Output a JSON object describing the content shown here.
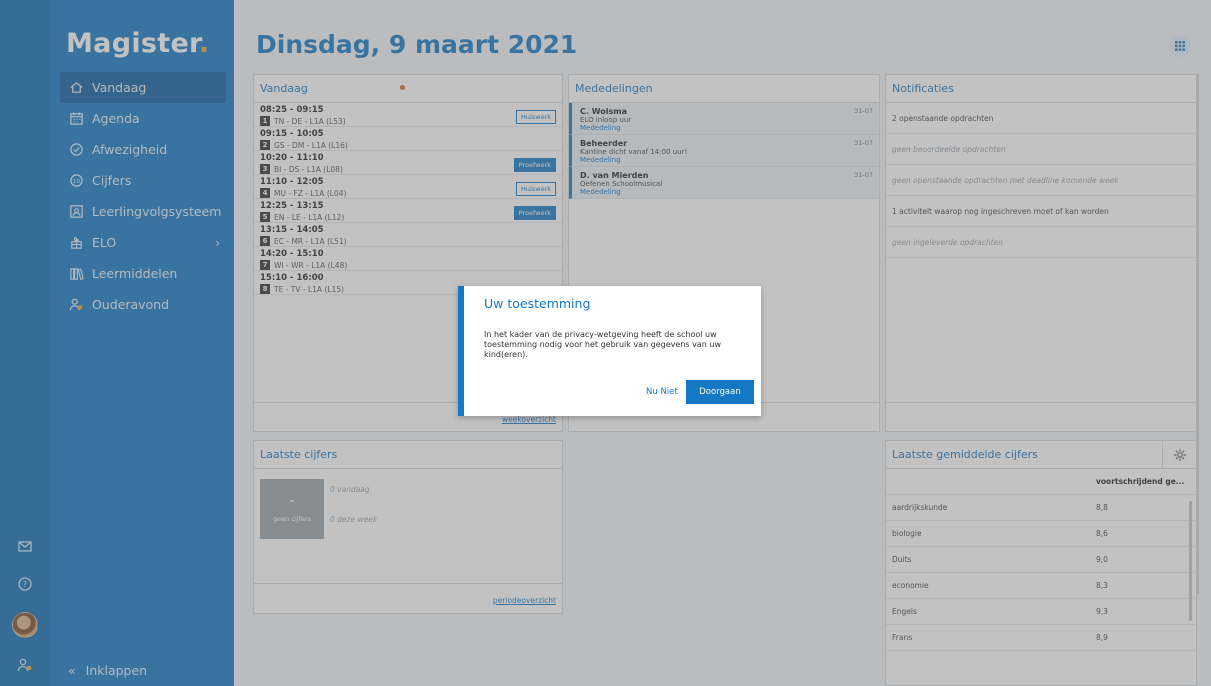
{
  "app": {
    "logo": "Magister",
    "logo_dot": "."
  },
  "sidebar": {
    "items": [
      {
        "label": "Vandaag",
        "icon": "home-icon"
      },
      {
        "label": "Agenda",
        "icon": "calendar-icon"
      },
      {
        "label": "Afwezigheid",
        "icon": "check-circle-icon"
      },
      {
        "label": "Cijfers",
        "icon": "grade-icon"
      },
      {
        "label": "Leerlingvolgsysteem",
        "icon": "person-card-icon"
      },
      {
        "label": "ELO",
        "icon": "elo-icon",
        "chevron": "›"
      },
      {
        "label": "Leermiddelen",
        "icon": "books-icon"
      },
      {
        "label": "Ouderavond",
        "icon": "people-icon"
      }
    ],
    "collapse_label": "Inklappen",
    "collapse_icon": "«"
  },
  "header": {
    "title": "Dinsdag, 9 maart 2021"
  },
  "today": {
    "title": "Vandaag",
    "lessons": [
      {
        "time": "08:25 - 09:15",
        "num": "1",
        "desc": "TN - DE - L1A (L53)",
        "tag": "Huiswerk",
        "tag_style": "outline"
      },
      {
        "time": "09:15 - 10:05",
        "num": "2",
        "desc": "GS - DM - L1A (L16)",
        "tag": "",
        "tag_style": ""
      },
      {
        "time": "10:20 - 11:10",
        "num": "3",
        "desc": "BI - DS - L1A (L08)",
        "tag": "Proefwerk",
        "tag_style": "filled"
      },
      {
        "time": "11:10 - 12:05",
        "num": "4",
        "desc": "MU - FZ - L1A (L04)",
        "tag": "Huiswerk",
        "tag_style": "outline"
      },
      {
        "time": "12:25 - 13:15",
        "num": "5",
        "desc": "EN - LE - L1A (L12)",
        "tag": "Proefwerk",
        "tag_style": "filled"
      },
      {
        "time": "13:15 - 14:05",
        "num": "6",
        "desc": "EC - MR - L1A (L51)",
        "tag": "",
        "tag_style": ""
      },
      {
        "time": "14:20 - 15:10",
        "num": "7",
        "desc": "WI - WR - L1A (L48)",
        "tag": "",
        "tag_style": ""
      },
      {
        "time": "15:10 - 16:00",
        "num": "8",
        "desc": "TE - TV - L1A (L15)",
        "tag": "",
        "tag_style": ""
      }
    ],
    "footer_link": "weekoverzicht"
  },
  "messages": {
    "title": "Mededelingen",
    "items": [
      {
        "from": "C. Wolsma",
        "text": "ELO inloop uur",
        "category": "Mededeling",
        "time": "31-07"
      },
      {
        "from": "Beheerder",
        "text": "Kantine dicht vanaf 14:00 uur!",
        "category": "Mededeling",
        "time": "31-07"
      },
      {
        "from": "D. van Mierden",
        "text": "Oefenen Schoolmusical",
        "category": "Mededeling",
        "time": "31-07"
      }
    ]
  },
  "notifications": {
    "title": "Notificaties",
    "items": [
      {
        "text": "2 openstaande opdrachten",
        "muted": false
      },
      {
        "text": "geen beoordeelde opdrachten",
        "muted": true
      },
      {
        "text": "geen openstaande opdrachten met deadline komende week",
        "muted": true
      },
      {
        "text": "1 activiteit waarop nog ingeschreven moet of kan worden",
        "muted": false
      },
      {
        "text": "geen ingeleverde opdrachten",
        "muted": true
      }
    ]
  },
  "latest_grades": {
    "title": "Laatste cijfers",
    "tile_value": "-",
    "tile_label": "geen cijfers",
    "today_label": "0 vandaag",
    "week_label": "0 deze week",
    "footer_link": "periodeoverzicht"
  },
  "averages": {
    "title": "Laatste gemiddelde cijfers",
    "column_header": "voortschrijdend ge...",
    "rows": [
      {
        "subject": "aardrijkskunde",
        "value": "8,8"
      },
      {
        "subject": "biologie",
        "value": "8,6"
      },
      {
        "subject": "Duits",
        "value": "9,0"
      },
      {
        "subject": "economie",
        "value": "8,3"
      },
      {
        "subject": "Engels",
        "value": "9,3"
      },
      {
        "subject": "Frans",
        "value": "8,9"
      }
    ]
  },
  "modal": {
    "title": "Uw toestemming",
    "body": "In het kader van de privacy-wetgeving heeft de school uw toestemming nodig voor het gebruik van gegevens van uw kind(eren).",
    "secondary_label": "Nu Niet",
    "primary_label": "Doorgaan"
  },
  "colors": {
    "brand": "#1478c4",
    "brand_dark": "#0c5da0",
    "accent": "#f6a623"
  }
}
